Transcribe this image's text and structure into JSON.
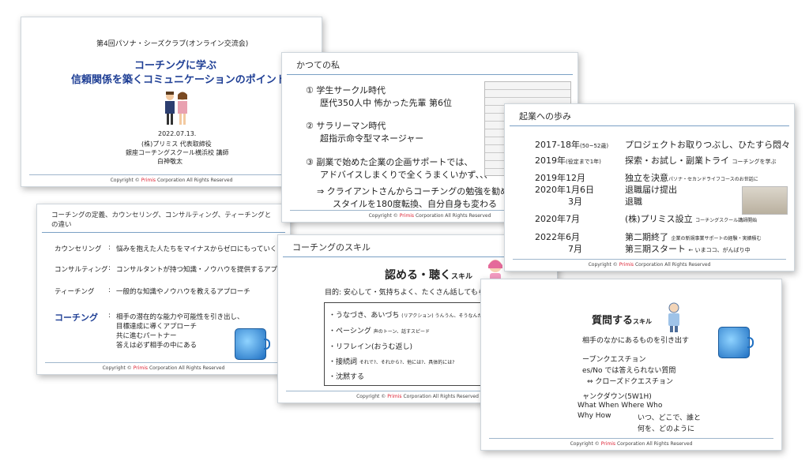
{
  "s1": {
    "event": "第4回パソナ・シーズクラブ(オンライン交流会)",
    "title1": "コーチングに学ぶ",
    "title2": "信頼関係を築くコミュニケーションのポイント",
    "date": "2022.07.13.",
    "line1": "(株)プリミス 代表取締役",
    "line2": "銀座コーチングスクール横浜校 講師",
    "line3": "白神敬太"
  },
  "s2": {
    "header": "かつての私",
    "i1a": "① 学生サークル時代",
    "i1b": "歴代350人中 怖かった先輩 第6位",
    "i2a": "② サラリーマン時代",
    "i2b": "超指示命令型マネージャー",
    "i3a": "③ 副業で始めた企業の企画サポートでは、",
    "i3b": "アドバイスしまくりで全くうまくいかず、、、",
    "i4a": "⇒ クライアントさんからコーチングの勉強を勧めら",
    "i4b": "スタイルを180度転換、自分自身も変わる"
  },
  "s3": {
    "header": "起業への歩み",
    "rows": [
      {
        "d": "2017-18年",
        "ds": "(50~52歳)",
        "t": "プロジェクトお取りつぶし、ひたすら悶々",
        "ts": ""
      },
      {
        "d": "2019年",
        "ds": "(役定まで1年)",
        "t": "探索・お試し・副業トライ",
        "ts": "コーチングを学ぶ"
      },
      {
        "d": "2019年12月",
        "ds": "",
        "t": "独立を決意",
        "ts": "パソナ・セカンドライフコースのお世話に"
      },
      {
        "d": "2020年1月6日",
        "ds": "",
        "t": "退職届け提出",
        "ts": ""
      },
      {
        "d": "3月",
        "ds": "",
        "t": "退職",
        "ts": ""
      },
      {
        "d": "2020年7月",
        "ds": "",
        "t": "(株)プリミス設立",
        "ts": "コーチングスクール講師開始"
      },
      {
        "d": "2022年6月",
        "ds": "",
        "t": "第二期終了",
        "ts": "企業の新規事業サポートの経験・実績積む"
      },
      {
        "d": "7月",
        "ds": "",
        "t": "第三期スタート",
        "ts": "← いまココ、がんばり中"
      }
    ]
  },
  "s4": {
    "header": "コーチングの定義、カウンセリング、コンサルティング、ティーチングとの違い",
    "r1l": "カウンセリング",
    "r1t": "悩みを抱えた人たちをマイナスからゼロにもっていくア",
    "r2l": "コンサルティング",
    "r2t": "コンサルタントが持つ知識・ノウハウを提供するアプ",
    "r3l": "ティーチング",
    "r3t": "一般的な知識やノウハウを教えるアプローチ",
    "r4l": "コーチング",
    "r4a": "相手の潜在的な能力や可能性を引き出し、",
    "r4b": "目標達成に導くアプローチ",
    "r4c": "共に進むパートナー",
    "r4d": "答えは必ず相手の中にある",
    "colon": ":"
  },
  "s5": {
    "header": "コーチングのスキル",
    "title": "認める・聴く",
    "title_small": "スキル",
    "purpose": "目的:  安心して・気持ちよく、たくさん話してもらう",
    "items": [
      {
        "t": "・うなづき、あいづち",
        "s": "(リアクション)  うんうん、そうなんだ、なるほど"
      },
      {
        "t": "・ペーシング",
        "s": "声のトーン、話すスピード"
      },
      {
        "t": "・リフレイン(おうむ返し)",
        "s": ""
      },
      {
        "t": "・接続詞",
        "s": "それで?、それから?、他には?、具体的には?"
      },
      {
        "t": "・沈黙する",
        "s": ""
      }
    ]
  },
  "s6": {
    "title": "質問する",
    "title_small": "スキル",
    "sub": "相手のなかにあるものを引き出す",
    "l1": "ープンクエスチョン",
    "l2": "es/No では答えられない質問",
    "l3": "⇔ クローズドクエスチョン",
    "l4": "ャンクダウン(5W1H)",
    "l5": "What  When  Where  Who",
    "l6": "Why  How",
    "l7": "いつ、どこで、誰と",
    "l8": "何を、どのように"
  },
  "footer": {
    "pre": "Copyright ©",
    "brand": "Primis",
    "post": "Corporation All Rights Reserved"
  }
}
